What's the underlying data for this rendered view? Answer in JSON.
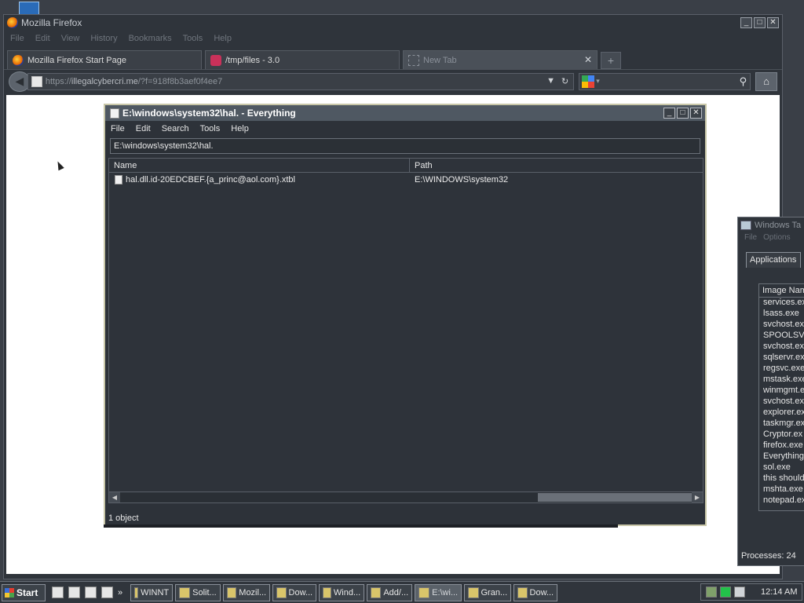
{
  "firefox": {
    "title": "Mozilla Firefox",
    "menu": [
      "File",
      "Edit",
      "View",
      "History",
      "Bookmarks",
      "Tools",
      "Help"
    ],
    "tabs": [
      {
        "label": "Mozilla Firefox Start Page",
        "active": false
      },
      {
        "label": "/tmp/files - 3.0",
        "active": false
      },
      {
        "label": "New Tab",
        "active": true
      }
    ],
    "url": {
      "scheme": "https://",
      "host": "illegalcybercri.me",
      "rest": "/?f=918f8b3aef0f4ee7"
    }
  },
  "everything": {
    "title": "E:\\windows\\system32\\hal. - Everything",
    "menu": [
      "File",
      "Edit",
      "Search",
      "Tools",
      "Help"
    ],
    "search_value": "E:\\windows\\system32\\hal.",
    "columns": [
      "Name",
      "Path"
    ],
    "rows": [
      {
        "name": "hal.dll.id-20EDCBEF.{a_princ@aol.com}.xtbl",
        "path": "E:\\WINDOWS\\system32"
      }
    ],
    "status": "1 object"
  },
  "taskmgr": {
    "title": "Windows Ta",
    "menu": [
      "File",
      "Options"
    ],
    "tab": "Applications",
    "column": "Image Nam",
    "processes": [
      "services.ex",
      "lsass.exe",
      "svchost.ex",
      "SPOOLSV.E",
      "svchost.ex",
      "sqlservr.ex",
      "regsvc.exe",
      "mstask.exe",
      "winmgmt.e",
      "svchost.ex",
      "explorer.ex",
      "taskmgr.ex",
      "Cryptor.ex",
      "firefox.exe",
      "Everything",
      "sol.exe",
      "this should",
      "mshta.exe",
      "notepad.ex"
    ],
    "status": "Processes: 24"
  },
  "taskbar": {
    "start": "Start",
    "quicklaunch_more": "»",
    "tasks": [
      {
        "label": "WINNT",
        "active": false
      },
      {
        "label": "Solit...",
        "active": false
      },
      {
        "label": "Mozil...",
        "active": false
      },
      {
        "label": "Dow...",
        "active": false
      },
      {
        "label": "Wind...",
        "active": false
      },
      {
        "label": "Add/...",
        "active": false
      },
      {
        "label": "E:\\wi...",
        "active": true
      },
      {
        "label": "Gran...",
        "active": false
      },
      {
        "label": "Dow...",
        "active": false
      }
    ],
    "clock": "12:14 AM"
  }
}
